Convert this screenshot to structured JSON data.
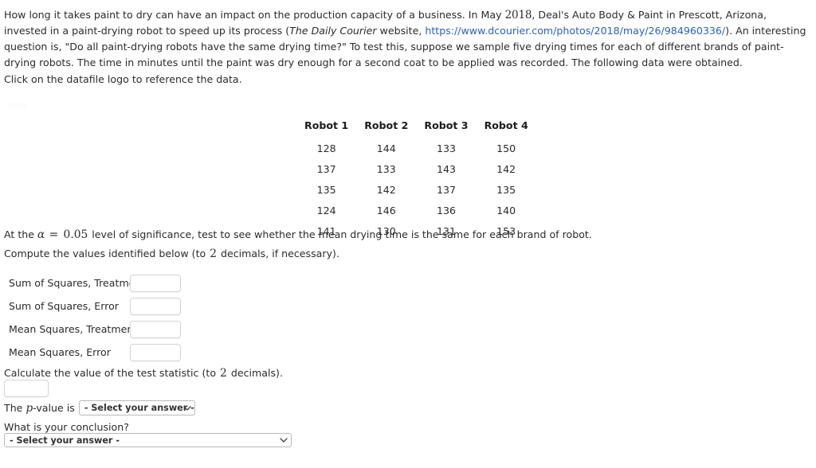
{
  "problem": {
    "intro_part1": "How long it takes paint to dry can have an impact on the production capacity of a business. In May ",
    "intro_year": "2018",
    "intro_part2": ", Deal's Auto Body & Paint in Prescott, Arizona, invested in a paint-drying robot to speed up its process (",
    "citation_italic": "The Daily Courier",
    "intro_part3": " website, ",
    "link_text": "https://www.dcourier.com/photos/2018/may/26/984960336/",
    "intro_part4": "). An interesting question is, \"Do all paint-drying robots have the same drying time?\" To test this, suppose we sample five drying times for each of different brands of paint-drying robots. The time in minutes until the paint was dry enough for a second coat to be applied was recorded. The following data were obtained.",
    "click_note": "Click on the datafile logo to reference the data."
  },
  "datafile": {
    "alt_text": "datafile"
  },
  "table": {
    "headers": [
      "Robot 1",
      "Robot 2",
      "Robot 3",
      "Robot 4"
    ],
    "rows": [
      [
        "128",
        "144",
        "133",
        "150"
      ],
      [
        "137",
        "133",
        "143",
        "142"
      ],
      [
        "135",
        "142",
        "137",
        "135"
      ],
      [
        "124",
        "146",
        "136",
        "140"
      ],
      [
        "141",
        "130",
        "131",
        "153"
      ]
    ]
  },
  "significance": {
    "lead": "At the ",
    "alpha_symbol": "α",
    "equals": " = ",
    "alpha_value": "0.05",
    "trail": " level of significance, test to see whether the mean drying time is the same for each brand of robot."
  },
  "compute": {
    "lead": "Compute the values identified below (to ",
    "decimals": "2",
    "trail": " decimals, if necessary)."
  },
  "fields": [
    {
      "label": "Sum of Squares, Treatment",
      "value": "",
      "name": "sum-of-squares-treatment"
    },
    {
      "label": "Sum of Squares, Error",
      "value": "",
      "name": "sum-of-squares-error"
    },
    {
      "label": "Mean Squares, Treatment",
      "value": "",
      "name": "mean-squares-treatment"
    },
    {
      "label": "Mean Squares, Error",
      "value": "",
      "name": "mean-squares-error"
    }
  ],
  "test_statistic": {
    "lead": "Calculate the value of the test statistic (to ",
    "decimals": "2",
    "trail": " decimals).",
    "value": ""
  },
  "pvalue": {
    "lead_before": "The ",
    "italic_p": "p",
    "lead_after": "-value is",
    "selected": "- Select your answer -"
  },
  "conclusion": {
    "question": "What is your conclusion?",
    "selected": "- Select your answer -"
  },
  "colors": {
    "link": "#2a61c2",
    "text": "#2b2b2b",
    "input_border": "#d4d4d4",
    "select_border": "#b9b9b9"
  }
}
